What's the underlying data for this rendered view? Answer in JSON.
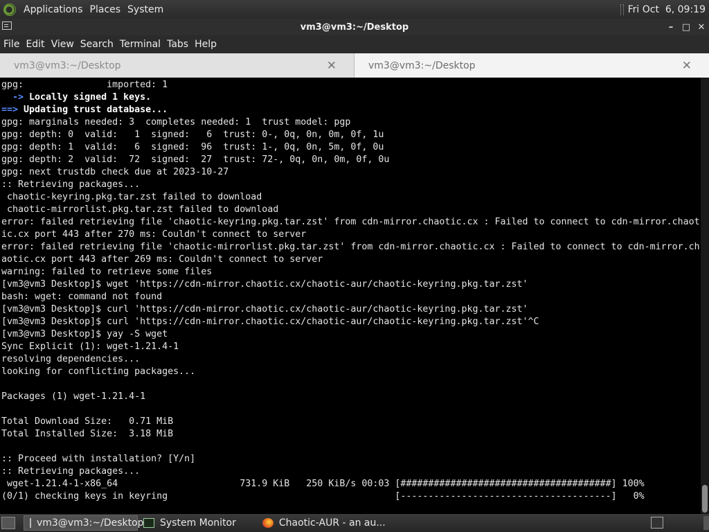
{
  "top_panel": {
    "menus": [
      "Applications",
      "Places",
      "System"
    ],
    "clock": "Fri Oct  6, 09:19"
  },
  "window": {
    "title": "vm3@vm3:~/Desktop",
    "controls": [
      "–",
      "□",
      "✕"
    ]
  },
  "menubar": [
    "File",
    "Edit",
    "View",
    "Search",
    "Terminal",
    "Tabs",
    "Help"
  ],
  "tabs": [
    {
      "label": "vm3@vm3:~/Desktop",
      "close": "✕"
    },
    {
      "label": "vm3@vm3:~/Desktop",
      "close": "✕"
    }
  ],
  "terminal": {
    "lines": [
      {
        "text": "gpg:               imported: 1"
      },
      {
        "text": "  -> Locally signed 1 keys.",
        "style": "arrow"
      },
      {
        "text": "==> Updating trust database...",
        "style": "header"
      },
      {
        "text": "gpg: marginals needed: 3  completes needed: 1  trust model: pgp"
      },
      {
        "text": "gpg: depth: 0  valid:   1  signed:   6  trust: 0-, 0q, 0n, 0m, 0f, 1u"
      },
      {
        "text": "gpg: depth: 1  valid:   6  signed:  96  trust: 1-, 0q, 0n, 5m, 0f, 0u"
      },
      {
        "text": "gpg: depth: 2  valid:  72  signed:  27  trust: 72-, 0q, 0n, 0m, 0f, 0u"
      },
      {
        "text": "gpg: next trustdb check due at 2023-10-27"
      },
      {
        "text": ":: Retrieving packages..."
      },
      {
        "text": " chaotic-keyring.pkg.tar.zst failed to download"
      },
      {
        "text": " chaotic-mirrorlist.pkg.tar.zst failed to download"
      },
      {
        "text": "error: failed retrieving file 'chaotic-keyring.pkg.tar.zst' from cdn-mirror.chaotic.cx : Failed to connect to cdn-mirror.chaot"
      },
      {
        "text": "ic.cx port 443 after 270 ms: Couldn't connect to server"
      },
      {
        "text": "error: failed retrieving file 'chaotic-mirrorlist.pkg.tar.zst' from cdn-mirror.chaotic.cx : Failed to connect to cdn-mirror.ch"
      },
      {
        "text": "aotic.cx port 443 after 269 ms: Couldn't connect to server"
      },
      {
        "text": "warning: failed to retrieve some files"
      },
      {
        "text": "[vm3@vm3 Desktop]$ wget 'https://cdn-mirror.chaotic.cx/chaotic-aur/chaotic-keyring.pkg.tar.zst'"
      },
      {
        "text": "bash: wget: command not found"
      },
      {
        "text": "[vm3@vm3 Desktop]$ curl 'https://cdn-mirror.chaotic.cx/chaotic-aur/chaotic-keyring.pkg.tar.zst'"
      },
      {
        "text": "[vm3@vm3 Desktop]$ curl 'https://cdn-mirror.chaotic.cx/chaotic-aur/chaotic-keyring.pkg.tar.zst'^C"
      },
      {
        "text": "[vm3@vm3 Desktop]$ yay -S wget"
      },
      {
        "text": "Sync Explicit (1): wget-1.21.4-1"
      },
      {
        "text": "resolving dependencies..."
      },
      {
        "text": "looking for conflicting packages..."
      },
      {
        "text": ""
      },
      {
        "text": "Packages (1) wget-1.21.4-1"
      },
      {
        "text": ""
      },
      {
        "text": "Total Download Size:   0.71 MiB"
      },
      {
        "text": "Total Installed Size:  3.18 MiB"
      },
      {
        "text": ""
      },
      {
        "text": ":: Proceed with installation? [Y/n]"
      },
      {
        "text": ":: Retrieving packages..."
      },
      {
        "text": " wget-1.21.4-1-x86_64                      731.9 KiB   250 KiB/s 00:03 [######################################] 100%"
      },
      {
        "text": "(0/1) checking keys in keyring                                         [--------------------------------------]   0%"
      }
    ]
  },
  "taskbar": {
    "tasks": [
      {
        "label": "vm3@vm3:~/Desktop",
        "icon": "terminal-icon"
      },
      {
        "label": "System Monitor",
        "icon": "system-monitor-icon"
      },
      {
        "label": "Chaotic-AUR - an au...",
        "icon": "firefox-icon"
      }
    ]
  },
  "colors": {
    "terminal_bg": "#000000",
    "terminal_fg": "#e5e5e5",
    "arrow_color": "#5a8cff",
    "header_color": "#5a8cff",
    "panel_bg": "#2f2f2f",
    "tab_active_bg": "#f3f3f3"
  }
}
